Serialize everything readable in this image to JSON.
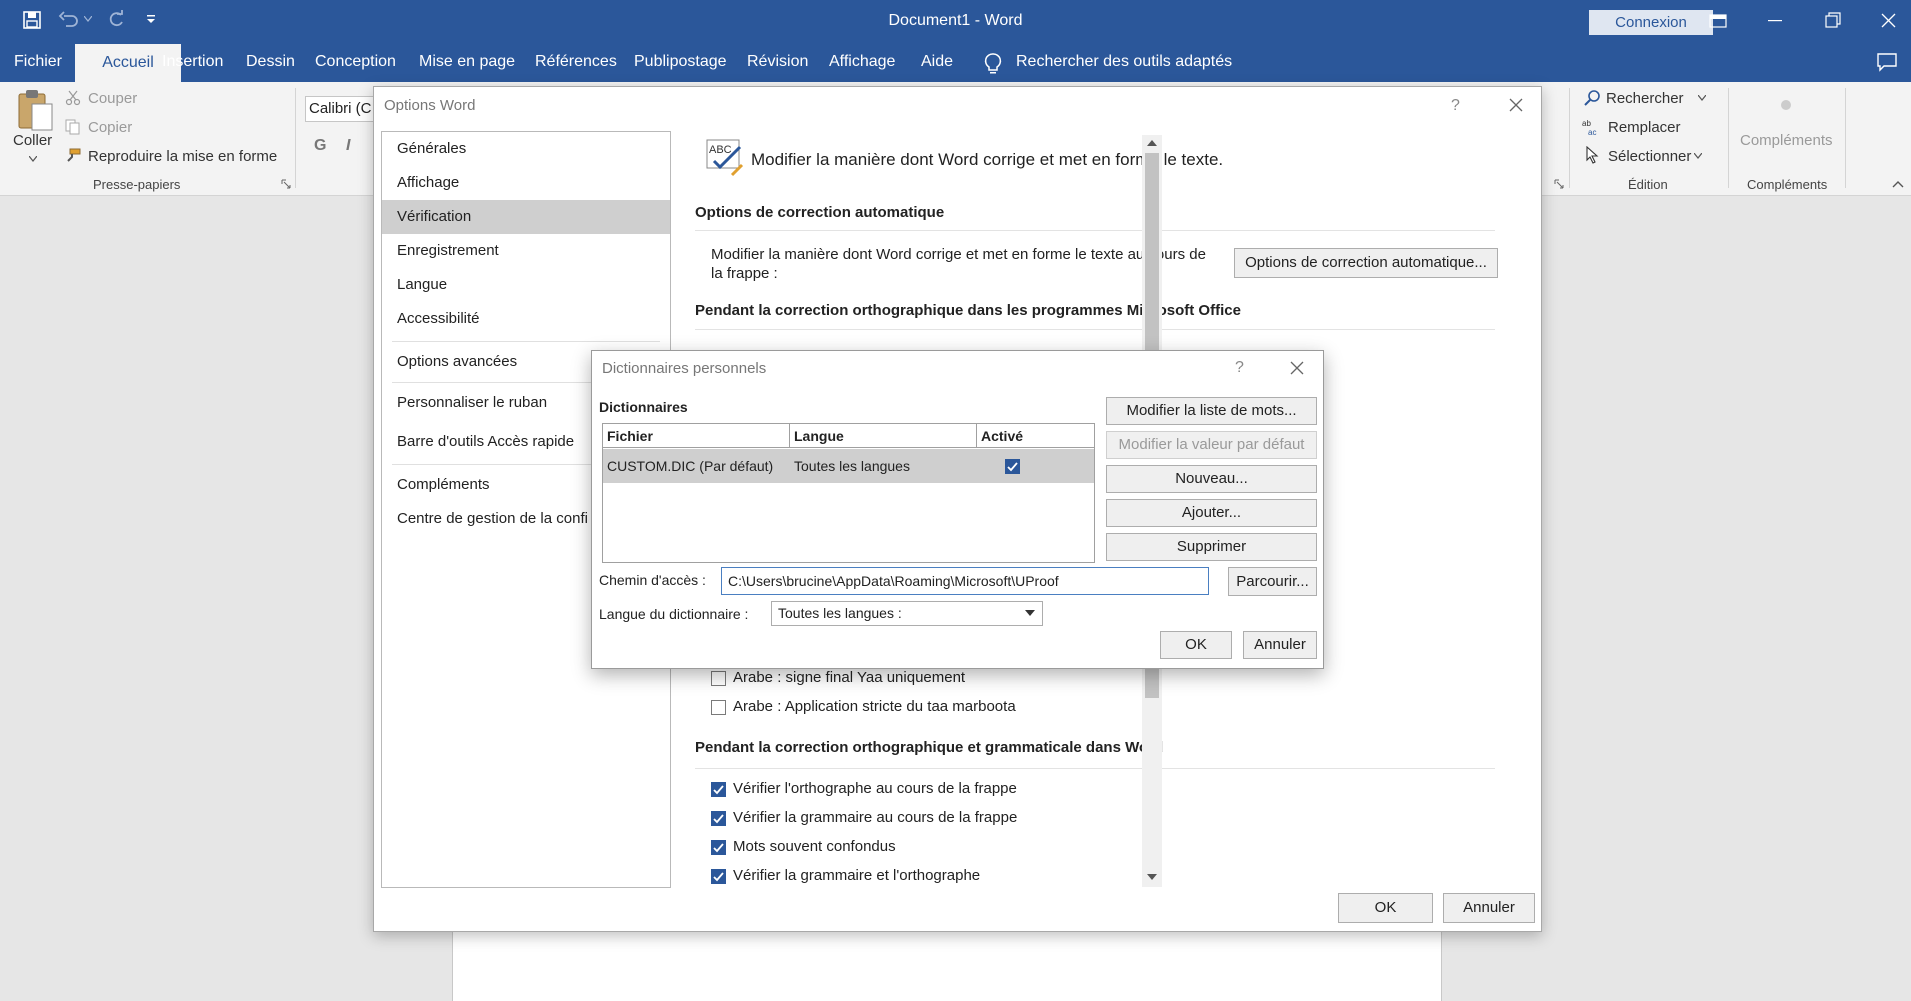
{
  "window": {
    "title": "Document1  -  Word",
    "connexion_label": "Connexion"
  },
  "tabs": [
    {
      "label": "Fichier"
    },
    {
      "label": "Accueil"
    },
    {
      "label": "Insertion"
    },
    {
      "label": "Dessin"
    },
    {
      "label": "Conception"
    },
    {
      "label": "Mise en page"
    },
    {
      "label": "Références"
    },
    {
      "label": "Publipostage"
    },
    {
      "label": "Révision"
    },
    {
      "label": "Affichage"
    },
    {
      "label": "Aide"
    }
  ],
  "tell_me": "Rechercher des outils adaptés",
  "ribbon": {
    "paste_label": "Coller",
    "cut_label": "Couper",
    "copy_label": "Copier",
    "format_painter_label": "Reproduire la mise en forme",
    "clipboard_group": "Presse-papiers",
    "font_name": "Calibri (C",
    "bold_label": "G",
    "italic_label": "I",
    "find_label": "Rechercher",
    "replace_label": "Remplacer",
    "select_label": "Sélectionner",
    "editing_group": "Édition",
    "addins_label": "Compléments",
    "addins_group": "Compléments"
  },
  "options_dialog": {
    "title": "Options Word",
    "help": "?",
    "nav": [
      {
        "label": "Générales"
      },
      {
        "label": "Affichage"
      },
      {
        "label": "Vérification"
      },
      {
        "label": "Enregistrement"
      },
      {
        "label": "Langue"
      },
      {
        "label": "Accessibilité"
      },
      {
        "label": "Options avancées"
      },
      {
        "label": "Personnaliser le ruban"
      },
      {
        "label": "Barre d'outils Accès rapide"
      },
      {
        "label": "Compléments"
      },
      {
        "label": "Centre de gestion de la confi"
      }
    ],
    "intro": "Modifier la manière dont Word corrige et met en forme le texte.",
    "section_autocorrect": "Options de correction automatique",
    "autocorrect_desc_line1": "Modifier la manière dont Word corrige et met en forme le texte au cours de",
    "autocorrect_desc_line2": "la frappe :",
    "autocorrect_button": "Options de correction automatique...",
    "section_office": "Pendant la correction orthographique dans les programmes Microsoft Office",
    "arabic_options": [
      {
        "label": "Arabe : signe final Yaa uniquement",
        "checked": false
      },
      {
        "label": "Arabe : Application stricte du taa marboota",
        "checked": false
      }
    ],
    "section_word": "Pendant la correction orthographique et grammaticale dans Word",
    "word_options": [
      {
        "label": "Vérifier l'orthographe au cours de la frappe",
        "checked": true
      },
      {
        "label": "Vérifier la grammaire au cours de la frappe",
        "checked": true
      },
      {
        "label": "Mots souvent confondus",
        "checked": true
      },
      {
        "label": "Vérifier la grammaire et l'orthographe",
        "checked": true
      }
    ],
    "ok_label": "OK",
    "cancel_label": "Annuler"
  },
  "dictionaries_dialog": {
    "title": "Dictionnaires personnels",
    "help": "?",
    "section": "Dictionnaires",
    "columns": [
      "Fichier",
      "Langue",
      "Activé"
    ],
    "rows": [
      {
        "file": "CUSTOM.DIC (Par défaut)",
        "language": "Toutes les langues",
        "active": true
      }
    ],
    "buttons": {
      "edit_list": "Modifier la liste de mots...",
      "set_default": "Modifier la valeur par défaut",
      "new": "Nouveau...",
      "add": "Ajouter...",
      "remove": "Supprimer",
      "browse": "Parcourir...",
      "ok": "OK",
      "cancel": "Annuler"
    },
    "path_label": "Chemin d'accès :",
    "path_value": "C:\\Users\\brucine\\AppData\\Roaming\\Microsoft\\UProof",
    "language_label": "Langue du dictionnaire :",
    "language_value": "Toutes les langues :"
  },
  "colors": {
    "word_blue": "#2b579a",
    "ribbon_bg": "#f3f3f3",
    "selection_gray": "#cfcfcf"
  },
  "icons": [
    "save-icon",
    "undo-icon",
    "redo-icon",
    "customize-qat-icon",
    "lightbulb-icon",
    "comments-icon",
    "paste-icon",
    "scissors-icon",
    "copy-icon",
    "format-painter-icon",
    "search-icon",
    "replace-icon",
    "select-cursor-icon",
    "abc-check-icon",
    "close-icon",
    "checkbox-check-icon",
    "dropdown-arrow-icon"
  ]
}
